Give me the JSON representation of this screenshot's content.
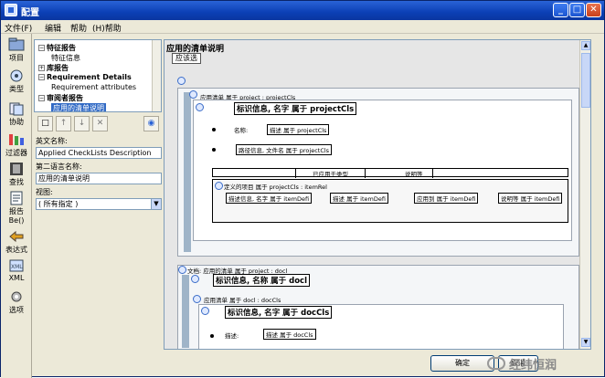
{
  "window": {
    "title": "配置"
  },
  "titlebar": {
    "min": "_",
    "max": "□",
    "close": "✕"
  },
  "menu": [
    "文件(F)",
    "编辑",
    "帮助",
    "(H)帮助"
  ],
  "iconbar": [
    {
      "label": "项目",
      "icon": "project-icon"
    },
    {
      "label": "类型",
      "icon": "type-icon"
    },
    {
      "label": "协助",
      "icon": "assist-icon"
    },
    {
      "label": "过滤器",
      "icon": "filter-icon"
    },
    {
      "label": "查找",
      "icon": "find-icon"
    },
    {
      "label": "报告 Be()",
      "icon": "report-icon"
    },
    {
      "label": "表达式",
      "icon": "expression-icon"
    },
    {
      "label": "XML",
      "icon": "xml-icon"
    },
    {
      "label": "选项",
      "icon": "options-icon"
    }
  ],
  "tree": [
    {
      "label": "特征报告",
      "expander": "⊟",
      "indent": 0
    },
    {
      "label": "特征信息",
      "expander": "",
      "indent": 1
    },
    {
      "label": "库报告",
      "expander": "⊞",
      "indent": 0
    },
    {
      "label": "Requirement Details",
      "expander": "⊟",
      "indent": 0
    },
    {
      "label": "Requirement attributes",
      "expander": "",
      "indent": 1
    },
    {
      "label": "审阅者报告",
      "expander": "⊟",
      "indent": 0
    },
    {
      "label": "应用的清单说明",
      "expander": "",
      "indent": 1,
      "selected": true
    }
  ],
  "toolbar": [
    "□",
    "↑",
    "↓",
    "✕",
    "◉"
  ],
  "fields": {
    "english_name_label": "英文名称:",
    "english_name_value": "Applied CheckLists Description",
    "second_lang_label": "第二语言名称:",
    "second_lang_value": "应用的清单说明",
    "view_label": "视图:",
    "view_value": "( 所有指定 )"
  },
  "doc": {
    "header": "应用的清单说明",
    "header_button": "应该选",
    "section1": {
      "caption": "应用清单 属于 project : projectCls",
      "title": "标识信息, 名字 属于 projectCls",
      "row1_label": "名称:",
      "row1_value": "描述 属于 projectCls",
      "row2_value": "路径信息, 文件名 属于 projectCls",
      "table_headers": [
        "已应用于类型",
        "说明等"
      ],
      "sub_caption": "定义的项目 属于 projectCls : itemRel",
      "sub_cells": [
        "描述信息, 名字 属于 itemDefi",
        "描述 属于 itemDefi",
        "应用到 属于 itemDefi",
        "说明等 属于 itemDefi"
      ]
    },
    "section2": {
      "caption": "文档: 应用的清单 属于 project : docl",
      "title": "标识信息, 名称 属于 docl",
      "sub_caption": "应用清单 属于 docl : docCls",
      "sub_title": "标识信息, 名字 属于 docCls",
      "row_label": "描述:",
      "row_value": "描述 属于 docCls"
    }
  },
  "buttons": {
    "ok": "确定",
    "cancel": "取消"
  },
  "watermark": "经纬恒润"
}
